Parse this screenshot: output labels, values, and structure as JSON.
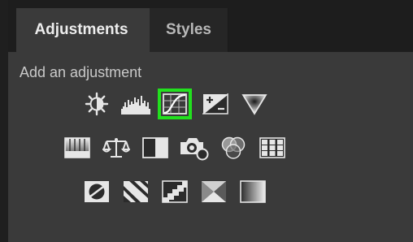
{
  "tabs": [
    {
      "label": "Adjustments",
      "active": true
    },
    {
      "label": "Styles",
      "active": false
    }
  ],
  "section": {
    "title": "Add an adjustment"
  },
  "icons": {
    "row1": [
      "brightness-contrast-icon",
      "levels-icon",
      "curves-icon",
      "exposure-icon",
      "vibrance-icon"
    ],
    "row2": [
      "hue-saturation-icon",
      "color-balance-icon",
      "black-white-icon",
      "photo-filter-icon",
      "channel-mixer-icon",
      "color-lookup-icon"
    ],
    "row3": [
      "invert-icon",
      "posterize-icon",
      "threshold-icon",
      "selective-color-icon",
      "gradient-map-icon"
    ],
    "selected": "curves-icon"
  },
  "colors": {
    "highlight": "#22e01e",
    "panel_bg": "#3a3a3a",
    "tabbar_bg": "#1d1d1d"
  }
}
